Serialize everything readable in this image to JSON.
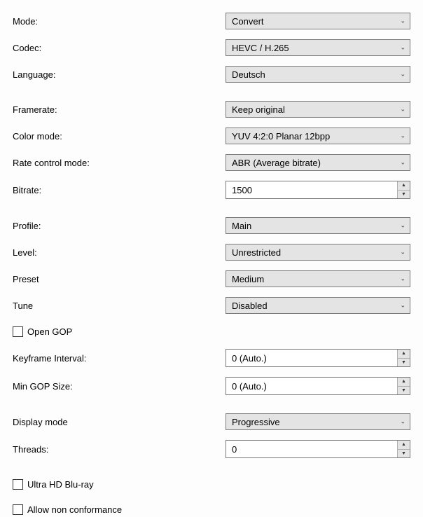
{
  "labels": {
    "mode": "Mode:",
    "codec": "Codec:",
    "language": "Language:",
    "framerate": "Framerate:",
    "colorMode": "Color mode:",
    "rateControl": "Rate control mode:",
    "bitrate": "Bitrate:",
    "profile": "Profile:",
    "level": "Level:",
    "preset": "Preset",
    "tune": "Tune",
    "openGop": "Open GOP",
    "keyframeInterval": "Keyframe Interval:",
    "minGopSize": "Min GOP Size:",
    "displayMode": "Display mode",
    "threads": "Threads:",
    "ultraHdBluray": "Ultra HD Blu-ray",
    "allowNonConformance": "Allow non conformance"
  },
  "values": {
    "mode": "Convert",
    "codec": "HEVC / H.265",
    "language": "Deutsch",
    "framerate": "Keep original",
    "colorMode": "YUV 4:2:0 Planar 12bpp",
    "rateControl": "ABR (Average bitrate)",
    "bitrate": "1500",
    "profile": "Main",
    "level": "Unrestricted",
    "preset": "Medium",
    "tune": "Disabled",
    "keyframeInterval": "0 (Auto.)",
    "minGopSize": "0 (Auto.)",
    "displayMode": "Progressive",
    "threads": "0"
  },
  "checkboxes": {
    "openGop": false,
    "ultraHdBluray": false,
    "allowNonConformance": false
  }
}
